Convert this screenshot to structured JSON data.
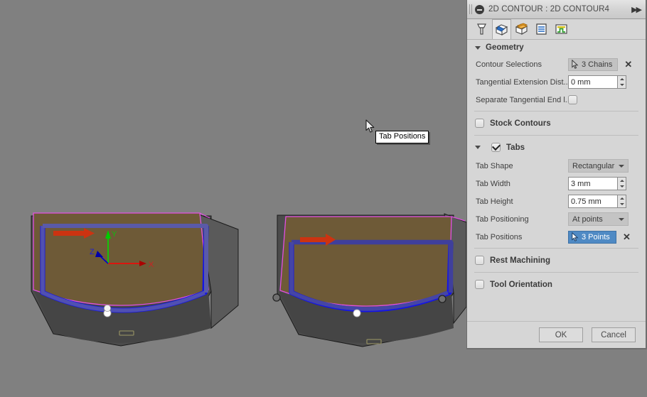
{
  "window": {
    "title": "2D CONTOUR : 2D CONTOUR4",
    "collapse_icon": "collapse-circle-icon",
    "expand_icon": "double-chevron-right-icon",
    "grip_icon": "drag-grip-icon"
  },
  "toolbar": {
    "tabs": [
      {
        "name": "tool-tab",
        "icon": "end-mill-icon",
        "selected": false
      },
      {
        "name": "geometry-tab",
        "icon": "blue-cube-geometry-icon",
        "selected": true
      },
      {
        "name": "heights-tab",
        "icon": "orange-cube-heights-icon",
        "selected": false
      },
      {
        "name": "passes-tab",
        "icon": "passes-layers-icon",
        "selected": false
      },
      {
        "name": "linking-tab",
        "icon": "linking-ramp-icon",
        "selected": false
      }
    ]
  },
  "geometry": {
    "header": "Geometry",
    "expanded": true,
    "contour_selections": {
      "label": "Contour Selections",
      "value": "3 Chains",
      "active": false,
      "clear": "✕"
    },
    "tangential_extension": {
      "label": "Tangential Extension Dist...",
      "value": "0 mm"
    },
    "separate_tangential": {
      "label": "Separate Tangential End l...",
      "checked": false
    }
  },
  "stock_contours": {
    "label": "Stock Contours",
    "checked": false
  },
  "tabs_section": {
    "header": "Tabs",
    "checked": true,
    "expanded": true,
    "tab_shape": {
      "label": "Tab Shape",
      "value": "Rectangular"
    },
    "tab_width": {
      "label": "Tab Width",
      "value": "3 mm"
    },
    "tab_height": {
      "label": "Tab Height",
      "value": "0.75 mm"
    },
    "tab_positioning": {
      "label": "Tab Positioning",
      "value": "At points"
    },
    "tab_positions": {
      "label": "Tab Positions",
      "value": "3 Points",
      "active": true,
      "clear": "✕"
    }
  },
  "rest_machining": {
    "label": "Rest Machining",
    "checked": false
  },
  "tool_orientation": {
    "label": "Tool Orientation",
    "checked": false
  },
  "footer": {
    "ok": "OK",
    "cancel": "Cancel"
  },
  "tooltip": {
    "text": "Tab Positions"
  },
  "viewport": {
    "background_color": "#808080",
    "axis_labels": {
      "x": "X",
      "y": "Y",
      "z": "Z"
    },
    "colors": {
      "top_face": "#6e5a37",
      "side_face": "#4a4a4a",
      "contour_magenta": "#e34fe3",
      "toolpath_blue": "#1414e6",
      "lead_blue": "#5a5aa8",
      "arrow_red": "#cc3311",
      "axis_x": "#ff0000",
      "axis_y": "#00dd00",
      "axis_z": "#0000cc",
      "tab_point_active": "#ffffff",
      "tab_point_inactive": "#707070"
    },
    "models": [
      {
        "name": "left-model",
        "tab_points_visible": 1
      },
      {
        "name": "right-model",
        "tab_points_visible": 3
      }
    ]
  }
}
